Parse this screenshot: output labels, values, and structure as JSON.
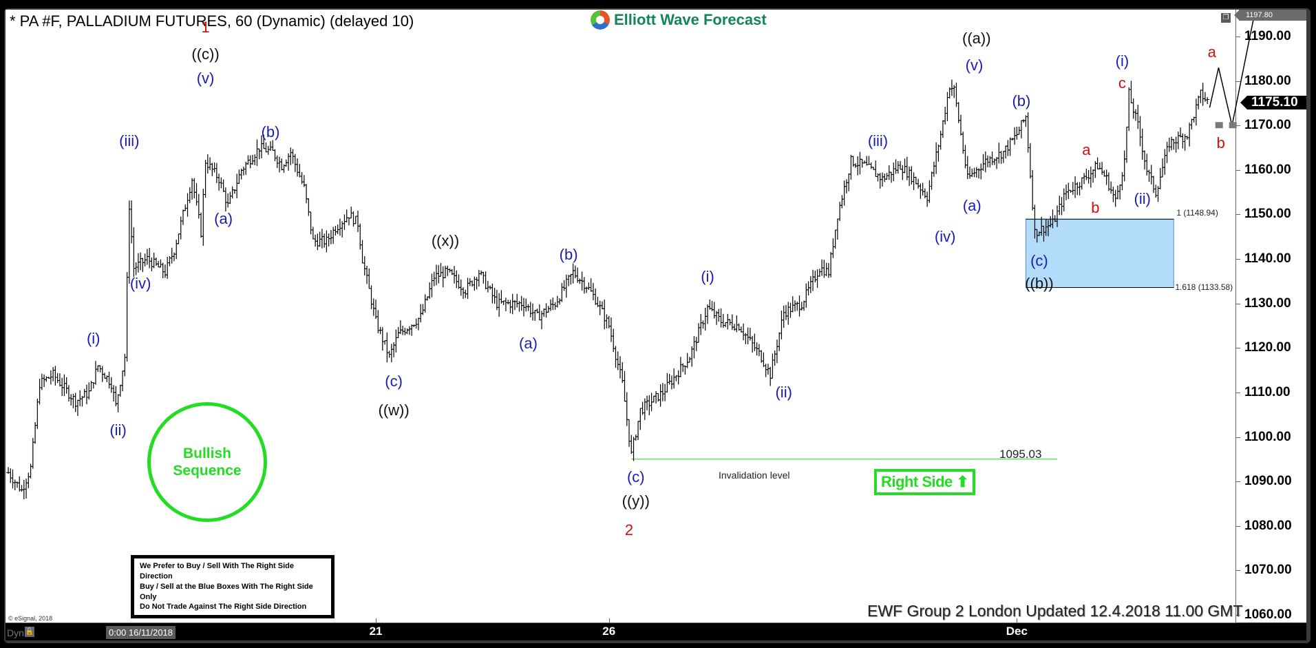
{
  "window": {
    "title": "* PA #F, PALLADIUM FUTURES, 60 (Dynamic) (delayed 10)",
    "brand": "Elliott Wave Forecast",
    "copyright": "© eSignal, 2018",
    "dyn_label": "Dyn",
    "cursor_datetime": "0:00 16/11/2018",
    "updated": "EWF Group 2 London Updated 12.4.2018 11.00 GMT"
  },
  "colors": {
    "wave_blue": "#1a1ab8",
    "wave_black": "#111111",
    "wave_red": "#d40d0d",
    "bullish_green": "#22dd22",
    "invalidation_green": "#66dd66",
    "blue_box": "#b3dcfa"
  },
  "panels": {
    "bullish": {
      "line1": "Bullish",
      "line2": "Sequence"
    },
    "right_side": "Right Side",
    "notice": [
      "We Prefer to Buy / Sell With The Right Side Direction",
      "Buy / Sell at the Blue Boxes With The Right Side Only",
      "Do Not Trade Against The Right Side Direction"
    ],
    "invalidation_label": "Invalidation level",
    "invalidation_value": "1095.03"
  },
  "chart_data": {
    "type": "ohlc",
    "title": "PA #F, PALLADIUM FUTURES, 60",
    "ylim": [
      1057,
      1198
    ],
    "yticks": [
      "1190.00",
      "1180.00",
      "1170.00",
      "1160.00",
      "1150.00",
      "1140.00",
      "1130.00",
      "1120.00",
      "1110.00",
      "1100.00",
      "1090.00",
      "1080.00",
      "1070.00",
      "1060.00"
    ],
    "ytick_values": [
      1190,
      1180,
      1170,
      1160,
      1150,
      1140,
      1130,
      1120,
      1110,
      1100,
      1090,
      1080,
      1070,
      1060
    ],
    "high_tag": "1197.80",
    "last_price": "1175.10",
    "last_price_value": 1175.1,
    "xticks": [
      {
        "label": "21",
        "bar": 164
      },
      {
        "label": "26",
        "bar": 268
      },
      {
        "label": "Dec",
        "bar": 450
      }
    ],
    "bar_count": 520,
    "price_path": [
      [
        0,
        1092
      ],
      [
        6,
        1088
      ],
      [
        10,
        1093
      ],
      [
        14,
        1112
      ],
      [
        20,
        1114
      ],
      [
        30,
        1108
      ],
      [
        36,
        1110
      ],
      [
        40,
        1116
      ],
      [
        46,
        1112
      ],
      [
        48,
        1107
      ],
      [
        52,
        1118
      ],
      [
        54,
        1152
      ],
      [
        56,
        1138
      ],
      [
        62,
        1140
      ],
      [
        70,
        1137
      ],
      [
        74,
        1142
      ],
      [
        78,
        1150
      ],
      [
        82,
        1158
      ],
      [
        86,
        1146
      ],
      [
        88,
        1162
      ],
      [
        94,
        1158
      ],
      [
        98,
        1152
      ],
      [
        104,
        1160
      ],
      [
        112,
        1165
      ],
      [
        118,
        1164
      ],
      [
        122,
        1161
      ],
      [
        126,
        1164
      ],
      [
        132,
        1156
      ],
      [
        136,
        1144
      ],
      [
        142,
        1144
      ],
      [
        146,
        1147
      ],
      [
        152,
        1150
      ],
      [
        156,
        1148
      ],
      [
        158,
        1140
      ],
      [
        164,
        1126
      ],
      [
        170,
        1118
      ],
      [
        174,
        1123
      ],
      [
        184,
        1127
      ],
      [
        190,
        1136
      ],
      [
        196,
        1137
      ],
      [
        204,
        1133
      ],
      [
        210,
        1137
      ],
      [
        218,
        1130
      ],
      [
        230,
        1130
      ],
      [
        236,
        1127
      ],
      [
        244,
        1130
      ],
      [
        252,
        1137
      ],
      [
        258,
        1134
      ],
      [
        262,
        1131
      ],
      [
        268,
        1125
      ],
      [
        274,
        1112
      ],
      [
        278,
        1096
      ],
      [
        282,
        1106
      ],
      [
        292,
        1110
      ],
      [
        304,
        1118
      ],
      [
        312,
        1129
      ],
      [
        318,
        1126
      ],
      [
        326,
        1125
      ],
      [
        336,
        1118
      ],
      [
        340,
        1114
      ],
      [
        346,
        1128
      ],
      [
        354,
        1130
      ],
      [
        362,
        1138
      ],
      [
        366,
        1137
      ],
      [
        370,
        1150
      ],
      [
        376,
        1162
      ],
      [
        382,
        1161
      ],
      [
        390,
        1158
      ],
      [
        398,
        1161
      ],
      [
        404,
        1158
      ],
      [
        410,
        1154
      ],
      [
        416,
        1168
      ],
      [
        420,
        1179
      ],
      [
        422,
        1178
      ],
      [
        428,
        1158
      ],
      [
        436,
        1162
      ],
      [
        444,
        1164
      ],
      [
        450,
        1168
      ],
      [
        454,
        1172
      ],
      [
        458,
        1146
      ],
      [
        462,
        1147
      ],
      [
        466,
        1148
      ],
      [
        472,
        1155
      ],
      [
        480,
        1158
      ],
      [
        486,
        1161
      ],
      [
        490,
        1158
      ],
      [
        494,
        1153
      ],
      [
        498,
        1162
      ],
      [
        500,
        1177
      ],
      [
        504,
        1170
      ],
      [
        508,
        1160
      ],
      [
        512,
        1155
      ],
      [
        518,
        1166
      ],
      [
        526,
        1168
      ],
      [
        532,
        1177
      ],
      [
        536,
        1175
      ]
    ],
    "forecast_path": [
      [
        536,
        1174
      ],
      [
        540,
        1183
      ],
      [
        546,
        1170
      ],
      [
        556,
        1195
      ]
    ],
    "forecast_b_zone": {
      "price": 1170,
      "label": "b"
    },
    "invalidation": {
      "price": 1095.03,
      "from_bar": 278,
      "to_bar": 468
    },
    "blue_box": {
      "top": 1148.94,
      "bottom": 1133.58,
      "from_bar": 454,
      "to_bar": 520,
      "top_label": "1 (1148.94)",
      "bottom_label": "1.618 (1133.58)"
    },
    "wave_labels": [
      {
        "text": "1",
        "bar": 88,
        "price": 1192,
        "color": "red"
      },
      {
        "text": "((c))",
        "bar": 88,
        "price": 1186,
        "color": "black"
      },
      {
        "text": "(v)",
        "bar": 88,
        "price": 1180.5,
        "color": "blue"
      },
      {
        "text": "(iii)",
        "bar": 54,
        "price": 1166.5,
        "color": "blue"
      },
      {
        "text": "(iv)",
        "bar": 59,
        "price": 1134.5,
        "color": "blue"
      },
      {
        "text": "(i)",
        "bar": 38,
        "price": 1122,
        "color": "blue"
      },
      {
        "text": "(ii)",
        "bar": 49,
        "price": 1101.5,
        "color": "blue"
      },
      {
        "text": "(a)",
        "bar": 96,
        "price": 1149,
        "color": "blue"
      },
      {
        "text": "(b)",
        "bar": 117,
        "price": 1168.5,
        "color": "blue"
      },
      {
        "text": "(c)",
        "bar": 172,
        "price": 1112.5,
        "color": "blue"
      },
      {
        "text": "((w))",
        "bar": 172,
        "price": 1106,
        "color": "black"
      },
      {
        "text": "((x))",
        "bar": 195,
        "price": 1144,
        "color": "black"
      },
      {
        "text": "(a)",
        "bar": 232,
        "price": 1121,
        "color": "blue"
      },
      {
        "text": "(b)",
        "bar": 250,
        "price": 1141,
        "color": "blue"
      },
      {
        "text": "(c)",
        "bar": 280,
        "price": 1091,
        "color": "blue"
      },
      {
        "text": "((y))",
        "bar": 280,
        "price": 1085.5,
        "color": "black"
      },
      {
        "text": "2",
        "bar": 277,
        "price": 1079,
        "color": "red"
      },
      {
        "text": "(i)",
        "bar": 312,
        "price": 1136,
        "color": "blue"
      },
      {
        "text": "(ii)",
        "bar": 346,
        "price": 1110,
        "color": "blue"
      },
      {
        "text": "(iii)",
        "bar": 388,
        "price": 1166.5,
        "color": "blue"
      },
      {
        "text": "(iv)",
        "bar": 418,
        "price": 1145,
        "color": "blue"
      },
      {
        "text": "(a)",
        "bar": 430,
        "price": 1152,
        "color": "blue"
      },
      {
        "text": "((a))",
        "bar": 432,
        "price": 1189.5,
        "color": "black"
      },
      {
        "text": "(v)",
        "bar": 431,
        "price": 1183.5,
        "color": "blue"
      },
      {
        "text": "(b)",
        "bar": 452,
        "price": 1175.5,
        "color": "blue"
      },
      {
        "text": "(c)",
        "bar": 460,
        "price": 1139.5,
        "color": "blue"
      },
      {
        "text": "((b))",
        "bar": 460,
        "price": 1134.5,
        "color": "black"
      },
      {
        "text": "a",
        "bar": 481,
        "price": 1164.5,
        "color": "red"
      },
      {
        "text": "b",
        "bar": 485,
        "price": 1151.5,
        "color": "red"
      },
      {
        "text": "(i)",
        "bar": 497,
        "price": 1184.5,
        "color": "blue"
      },
      {
        "text": "c",
        "bar": 497,
        "price": 1179.5,
        "color": "red"
      },
      {
        "text": "(ii)",
        "bar": 506,
        "price": 1153.5,
        "color": "blue"
      },
      {
        "text": "a",
        "bar": 537,
        "price": 1186.5,
        "color": "red"
      },
      {
        "text": "b",
        "bar": 541,
        "price": 1166,
        "color": "red"
      }
    ]
  }
}
